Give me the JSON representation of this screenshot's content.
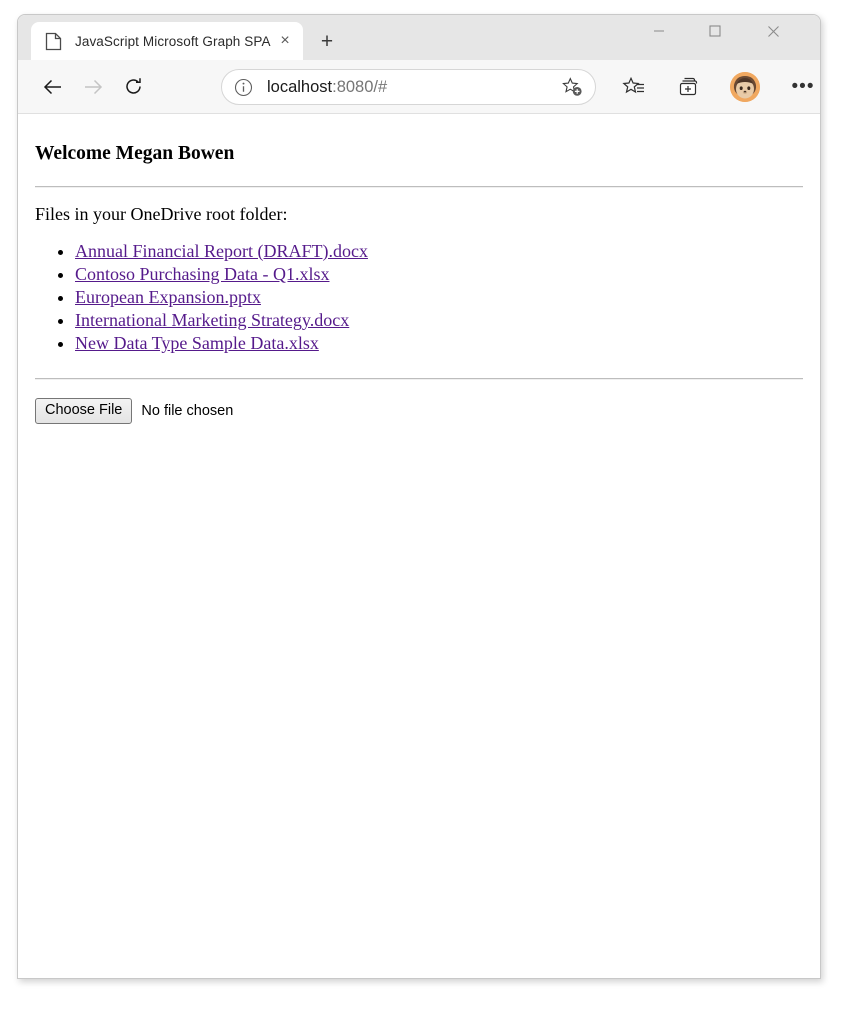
{
  "browser": {
    "tab": {
      "title": "JavaScript Microsoft Graph SPA",
      "icon": "page-icon",
      "close_label": "×"
    },
    "new_tab_label": "+",
    "window_controls": {
      "minimize": "minimize-icon",
      "maximize": "maximize-icon",
      "close": "close-icon"
    },
    "toolbar": {
      "back": "back-arrow-icon",
      "forward": "forward-arrow-icon",
      "refresh": "reload-icon",
      "site_info": "info-circle-icon",
      "url_host": "localhost",
      "url_rest": ":8080/#",
      "url_full": "localhost:8080/#",
      "add_favorite": "star-plus-icon",
      "favorites": "favorites-star-icon",
      "collections": "collections-icon",
      "profile": "avatar-icon",
      "settings": "•••"
    }
  },
  "page": {
    "heading": "Welcome Megan Bowen",
    "files_label": "Files in your OneDrive root folder:",
    "files": [
      {
        "name": "Annual Financial Report (DRAFT).docx"
      },
      {
        "name": "Contoso Purchasing Data - Q1.xlsx"
      },
      {
        "name": "European Expansion.pptx"
      },
      {
        "name": "International Marketing Strategy.docx"
      },
      {
        "name": "New Data Type Sample Data.xlsx"
      }
    ],
    "upload": {
      "button_label": "Choose File",
      "status_label": "No file chosen"
    },
    "colors": {
      "link": "#551a8b",
      "text": "#000000",
      "rule": "#bdbdbd"
    }
  }
}
